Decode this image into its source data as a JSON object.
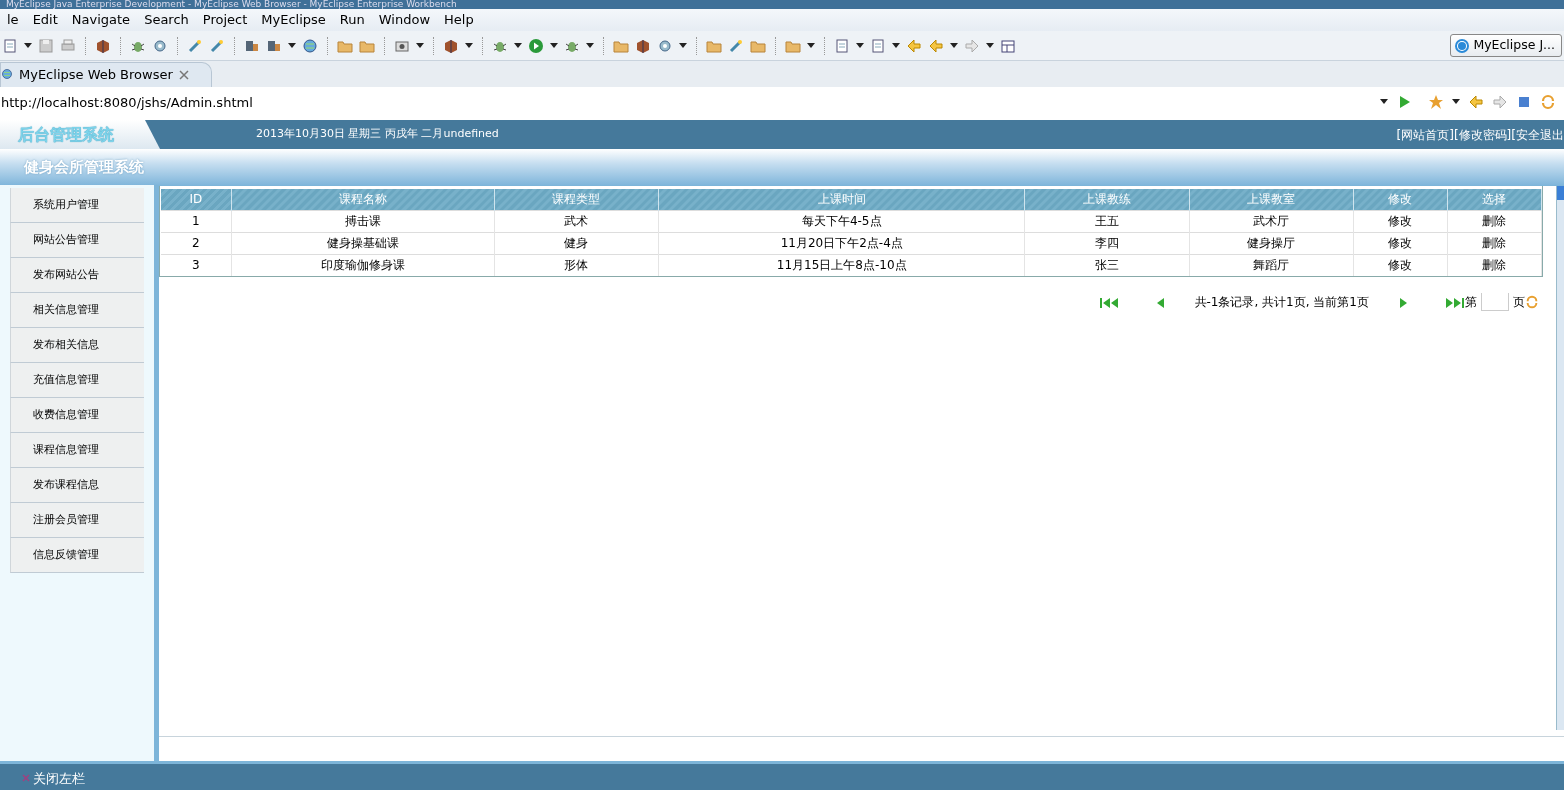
{
  "window": {
    "title": "MyEclipse Java Enterprise Development - MyEclipse Web Browser - MyEclipse Enterprise Workbench"
  },
  "menu": [
    "le",
    "Edit",
    "Navigate",
    "Search",
    "Project",
    "MyEclipse",
    "Run",
    "Window",
    "Help"
  ],
  "perspective_button": {
    "label": "MyEclipse J..."
  },
  "editor_tab": {
    "label": "MyEclipse Web Browser"
  },
  "address_bar": {
    "value": "http://localhost:8080/jshs/Admin.shtml"
  },
  "page": {
    "logo": "后台管理系统",
    "date": "2013年10月30日 星期三 丙戌年 二月undefined",
    "header_links": [
      "[网站首页]",
      "[修改密码]",
      "[安全退出"
    ],
    "system_title": "健身会所管理系统",
    "sidebar": {
      "items": [
        "系统用户管理",
        "网站公告管理",
        "发布网站公告",
        "相关信息管理",
        "发布相关信息",
        "充值信息管理",
        "收费信息管理",
        "课程信息管理",
        "发布课程信息",
        "注册会员管理",
        "信息反馈管理"
      ]
    },
    "table": {
      "columns": [
        "ID",
        "课程名称",
        "课程类型",
        "上课时间",
        "上课教练",
        "上课教室",
        "修改",
        "选择"
      ],
      "rows": [
        [
          "1",
          "搏击课",
          "武术",
          "每天下午4-5点",
          "王五",
          "武术厅",
          "修改",
          "删除"
        ],
        [
          "2",
          "健身操基础课",
          "健身",
          "11月20日下午2点-4点",
          "李四",
          "健身操厅",
          "修改",
          "删除"
        ],
        [
          "3",
          "印度瑜伽修身课",
          "形体",
          "11月15日上午8点-10点",
          "张三",
          "舞蹈厅",
          "修改",
          "删除"
        ]
      ]
    },
    "pagination": {
      "summary": "共-1条记录, 共计1页, 当前第1页",
      "page_prefix": "第",
      "page_suffix": "页"
    },
    "footer": {
      "close_sidebar": "关闭左栏"
    }
  }
}
